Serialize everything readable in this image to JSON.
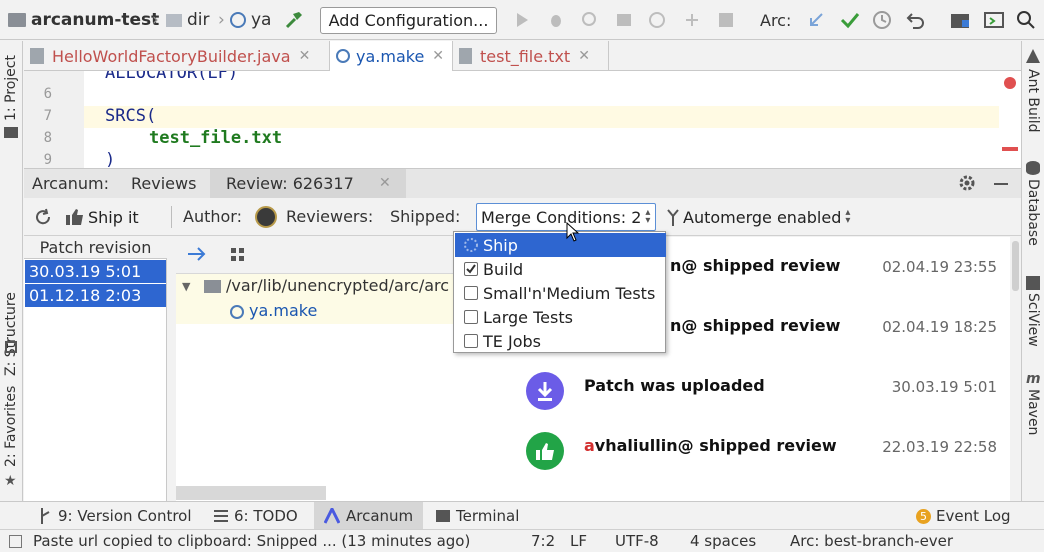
{
  "toolbar": {
    "project": "arcanum-test",
    "folder": "dir",
    "module": "ya",
    "add_configuration": "Add Configuration...",
    "arc_label": "Arc:"
  },
  "editor_tabs": [
    {
      "label": "HelloWorldFactoryBuilder.java",
      "color": "#c0504d"
    },
    {
      "label": "ya.make",
      "color": "#1a56b0"
    },
    {
      "label": "test_file.txt",
      "color": "#c0504d"
    }
  ],
  "editor": {
    "line_numbers": [
      "6",
      "7",
      "8",
      "9"
    ],
    "top_partial": "ALLOCATOR(LF)",
    "srcs": "SRCS",
    "paren_open": "(",
    "file": "test_file.txt",
    "paren_close": ")"
  },
  "left_strip": {
    "project": "1: Project",
    "structure": "Z: Structure",
    "favorites": "2: Favorites"
  },
  "right_strip": {
    "ant": "Ant Build",
    "database": "Database",
    "sciview": "SciView",
    "maven": "Maven"
  },
  "tool_window": {
    "title": "Arcanum:",
    "tabs": [
      "Reviews",
      "Review: 626317"
    ]
  },
  "review_bar": {
    "ship_it": "Ship it",
    "author": "Author:",
    "reviewers": "Reviewers:",
    "shipped": "Shipped:",
    "merge_conditions": "Merge Conditions: 2",
    "automerge": "Automerge enabled"
  },
  "patch_panel": {
    "header": "Patch revision",
    "rows": [
      "30.03.19 5:01",
      "01.12.18 2:03"
    ]
  },
  "file_tree": {
    "folder": "/var/lib/unencrypted/arc/arc",
    "file": "ya.make"
  },
  "dropdown": {
    "items": [
      {
        "label": "Ship",
        "checked": false,
        "selected": true
      },
      {
        "label": "Build",
        "checked": true,
        "selected": false
      },
      {
        "label": "Small'n'Medium Tests",
        "checked": false,
        "selected": false
      },
      {
        "label": "Large Tests",
        "checked": false,
        "selected": false
      },
      {
        "label": "TE Jobs",
        "checked": false,
        "selected": false
      }
    ]
  },
  "activity": [
    {
      "text": "n@ shipped review",
      "date": "02.04.19 23:55",
      "icon": "thumbs-up-icon",
      "color": "#22a447"
    },
    {
      "text": "n@ shipped review",
      "date": "02.04.19 18:25",
      "icon": "thumbs-up-icon",
      "color": "#22a447"
    },
    {
      "text": "Patch was uploaded",
      "date": "30.03.19 5:01",
      "icon": "upload-icon",
      "color": "#6b5ce7"
    },
    {
      "text_first": "a",
      "text_rest": "vhaliullin@ shipped review",
      "date": "22.03.19 22:58",
      "icon": "thumbs-up-icon",
      "color": "#22a447"
    }
  ],
  "bottom_tabs": {
    "version_control": "9: Version Control",
    "todo": "6: TODO",
    "arcanum": "Arcanum",
    "terminal": "Terminal",
    "event_log": "Event Log",
    "event_count": "5"
  },
  "status_bar": {
    "message": "Paste url copied to clipboard: Snipped ... (13 minutes ago)",
    "position": "7:2",
    "line_sep": "LF",
    "encoding": "UTF-8",
    "indent": "4 spaces",
    "branch": "Arc: best-branch-ever"
  }
}
